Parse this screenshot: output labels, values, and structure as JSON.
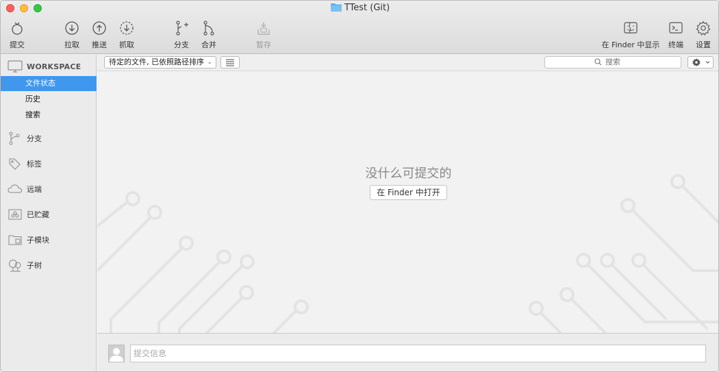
{
  "window": {
    "title": "TTest (Git)"
  },
  "toolbar": {
    "commit": "提交",
    "pull": "拉取",
    "push": "推送",
    "fetch": "抓取",
    "branch": "分支",
    "merge": "合并",
    "stash": "暂存",
    "show_in_finder": "在 Finder 中显示",
    "terminal": "终端",
    "settings": "设置"
  },
  "sidebar": {
    "workspace_header": "WORKSPACE",
    "workspace_items": [
      "文件状态",
      "历史",
      "搜索"
    ],
    "sections": [
      "分支",
      "标签",
      "远端",
      "已贮藏",
      "子模块",
      "子树"
    ]
  },
  "filterbar": {
    "sort_select": "待定的文件, 已依照路径排序",
    "search_placeholder": "搜索"
  },
  "main": {
    "empty_message": "没什么可提交的",
    "open_in_finder": "在 Finder 中打开"
  },
  "commit": {
    "placeholder": "提交信息"
  },
  "colors": {
    "accent": "#3f97ee",
    "sidebar_bg": "#ebebeb",
    "main_bg": "#f2f2f2"
  }
}
